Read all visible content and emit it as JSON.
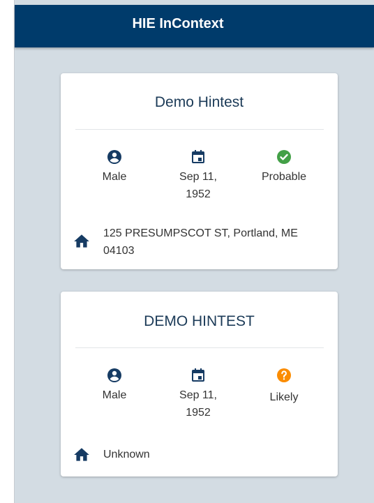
{
  "app": {
    "title": "HIE InContext"
  },
  "colors": {
    "header": "#003b6b",
    "background": "#d3dce3",
    "icon": "#163b63",
    "probable": "#43a047",
    "likely": "#fb8c00"
  },
  "patients": [
    {
      "name": "Demo Hintest",
      "gender": "Male",
      "gender_icon": "account-circle-icon",
      "dob": "Sep 11, 1952",
      "dob_icon": "calendar-icon",
      "match": "Probable",
      "match_icon": "check-circle-icon",
      "address": "125 PRESUMPSCOT ST, Portland, ME 04103",
      "address_icon": "home-icon"
    },
    {
      "name": "DEMO HINTEST",
      "gender": "Male",
      "gender_icon": "account-circle-icon",
      "dob": "Sep 11, 1952",
      "dob_icon": "calendar-icon",
      "match": "Likely",
      "match_icon": "help-circle-icon",
      "address": "Unknown",
      "address_icon": "home-icon"
    }
  ]
}
